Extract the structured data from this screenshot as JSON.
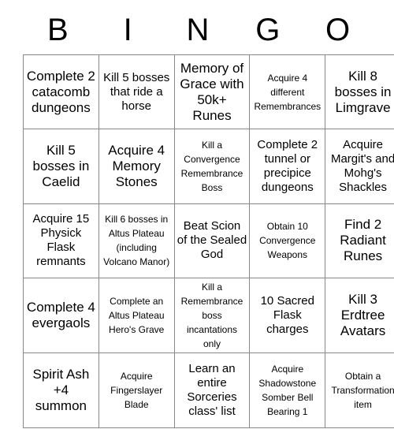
{
  "card": {
    "header_letters": [
      "B",
      "I",
      "N",
      "G",
      "O"
    ],
    "grid_size": 5,
    "border_color": "#888888",
    "text_color": "#000000",
    "background_color": "#ffffff",
    "rows": [
      [
        {
          "text": "Complete 2 catacomb dungeons",
          "size": "lg",
          "marked": false
        },
        {
          "text": "Kill 5 bosses that ride a horse",
          "size": "md",
          "marked": false
        },
        {
          "text": "Memory of Grace with 50k+ Runes",
          "size": "lg",
          "marked": false
        },
        {
          "text": "Acquire 4 different Remembrances",
          "size": "sm",
          "marked": false
        },
        {
          "text": "Kill 8 bosses in Limgrave",
          "size": "lg",
          "marked": false
        }
      ],
      [
        {
          "text": "Kill 5 bosses in Caelid",
          "size": "lg",
          "marked": false
        },
        {
          "text": "Acquire 4 Memory Stones",
          "size": "lg",
          "marked": false
        },
        {
          "text": "Kill a Convergence Remembrance Boss",
          "size": "sm",
          "marked": false
        },
        {
          "text": "Complete 2 tunnel or precipice dungeons",
          "size": "md",
          "marked": false
        },
        {
          "text": "Acquire Margit's and Mohg's Shackles",
          "size": "md",
          "marked": false
        }
      ],
      [
        {
          "text": "Acquire 15 Physick Flask remnants",
          "size": "md",
          "marked": false
        },
        {
          "text": "Kill 6 bosses in Altus Plateau (including Volcano Manor)",
          "size": "sm",
          "marked": false
        },
        {
          "text": "Beat Scion of the Sealed God",
          "size": "md",
          "marked": false
        },
        {
          "text": "Obtain 10 Convergence Weapons",
          "size": "sm",
          "marked": false
        },
        {
          "text": "Find 2 Radiant Runes",
          "size": "lg",
          "marked": false
        }
      ],
      [
        {
          "text": "Complete 4 evergaols",
          "size": "lg",
          "marked": false
        },
        {
          "text": "Complete an Altus Plateau Hero's Grave",
          "size": "sm",
          "marked": false
        },
        {
          "text": "Kill a Remembrance boss incantations only",
          "size": "sm",
          "marked": false
        },
        {
          "text": "10 Sacred Flask charges",
          "size": "md",
          "marked": false
        },
        {
          "text": "Kill 3 Erdtree Avatars",
          "size": "lg",
          "marked": false
        }
      ],
      [
        {
          "text": "Spirit Ash +4 summon",
          "size": "lg",
          "marked": false
        },
        {
          "text": "Acquire Fingerslayer Blade",
          "size": "sm",
          "marked": false
        },
        {
          "text": "Learn an entire Sorceries class' list",
          "size": "md",
          "marked": false
        },
        {
          "text": "Acquire Shadowstone Somber Bell Bearing 1",
          "size": "sm",
          "marked": false
        },
        {
          "text": "Obtain a Transformation item",
          "size": "sm",
          "marked": false
        }
      ]
    ]
  }
}
